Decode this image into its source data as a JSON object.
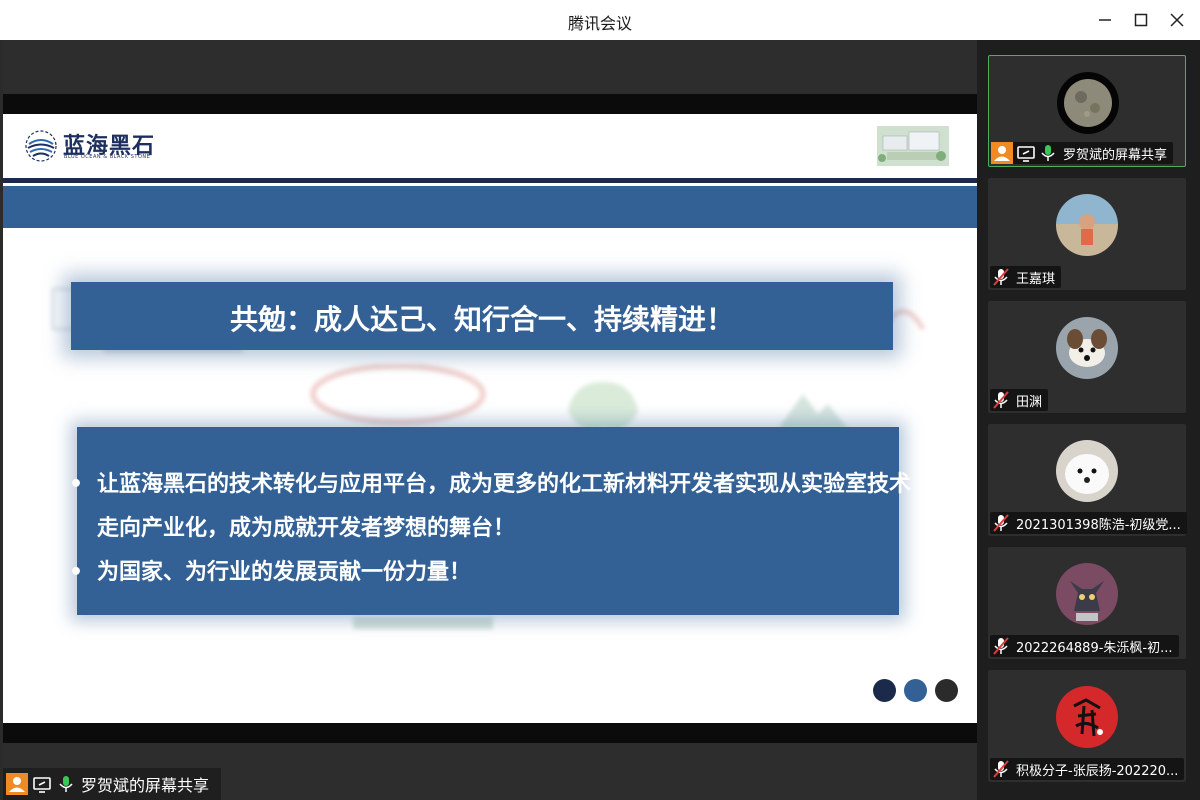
{
  "window": {
    "title": "腾讯会议",
    "minimize_icon": "minimize-icon",
    "maximize_icon": "maximize-icon",
    "close_icon": "close-icon"
  },
  "slide": {
    "logo_text": "蓝海黑石",
    "logo_subtext": "BLUE OCEAN & BLACK STONE",
    "motto": "共勉：成人达己、知行合一、持续精进！",
    "bullets": [
      "让蓝海黑石的技术转化与应用平台，成为更多的化工新材料开发者实现从实验室技术走向产业化，成为成就开发者梦想的舞台！",
      "为国家、为行业的发展贡献一份力量！"
    ],
    "nav_dots": [
      "#1b2a4a",
      "#336196",
      "#2b2b2b"
    ],
    "colors": {
      "band": "#336196",
      "navy": "#1b2a4a"
    }
  },
  "share_label": {
    "text": "罗贺斌的屏幕共享",
    "icons": [
      "user-icon",
      "screen-share-icon",
      "mic-icon"
    ]
  },
  "participants": [
    {
      "name": "罗贺斌的屏幕共享",
      "avatar": "moon-avatar",
      "mic": "on",
      "active": true,
      "sharing": true
    },
    {
      "name": "王嘉琪",
      "avatar": "beach-person-avatar",
      "mic": "muted",
      "active": false,
      "sharing": false
    },
    {
      "name": "田渊",
      "avatar": "dog-avatar",
      "mic": "muted",
      "active": false,
      "sharing": false
    },
    {
      "name": "2021301398陈浩-初级党...",
      "avatar": "white-dog-avatar",
      "mic": "muted",
      "active": false,
      "sharing": false
    },
    {
      "name": "2022264889-朱泺枫-初...",
      "avatar": "cartoon-cat-avatar",
      "mic": "muted",
      "active": false,
      "sharing": false
    },
    {
      "name": "积极分子-张辰扬-202220...",
      "avatar": "red-seal-avatar",
      "mic": "muted",
      "active": false,
      "sharing": false
    }
  ]
}
